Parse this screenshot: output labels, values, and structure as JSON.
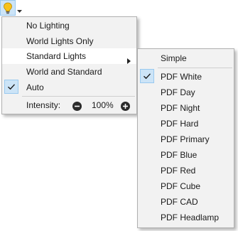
{
  "toolbar": {
    "icon": "lightbulb-icon",
    "dropdown_icon": "caret-down-icon"
  },
  "main_menu": {
    "items": [
      {
        "label": "No Lighting",
        "checked": false
      },
      {
        "label": "World Lights Only",
        "checked": false
      },
      {
        "label": "Standard Lights",
        "checked": false,
        "has_submenu": true,
        "highlighted": true
      },
      {
        "label": "World and Standard",
        "checked": false
      },
      {
        "label": "Auto",
        "checked": true
      }
    ],
    "intensity": {
      "label": "Intensity:",
      "value": "100%"
    }
  },
  "submenu": {
    "items": [
      {
        "label": "Simple",
        "checked": false
      },
      {
        "label": "PDF White",
        "checked": true
      },
      {
        "label": "PDF Day",
        "checked": false
      },
      {
        "label": "PDF Night",
        "checked": false
      },
      {
        "label": "PDF Hard",
        "checked": false
      },
      {
        "label": "PDF Primary",
        "checked": false
      },
      {
        "label": "PDF Blue",
        "checked": false
      },
      {
        "label": "PDF Red",
        "checked": false
      },
      {
        "label": "PDF Cube",
        "checked": false
      },
      {
        "label": "PDF CAD",
        "checked": false
      },
      {
        "label": "PDF Headlamp",
        "checked": false
      }
    ]
  },
  "colors": {
    "accent": "#cce4f7",
    "accent_border": "#99c9ef",
    "menu_bg": "#f2f2f2",
    "bulb": "#f7c21a"
  }
}
